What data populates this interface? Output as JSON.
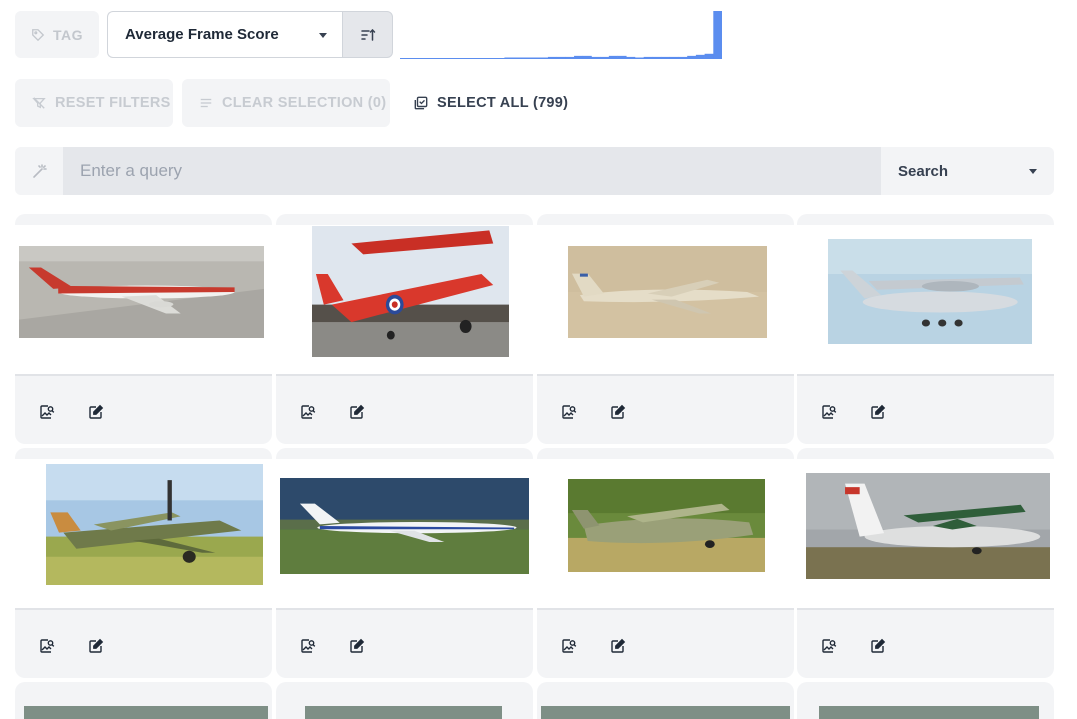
{
  "toolbar": {
    "tag_label": "TAG",
    "sort_field": "Average Frame Score",
    "reset_label": "RESET FILTERS",
    "clear_label": "CLEAR SELECTION (0)",
    "select_all_label": "SELECT ALL (799)"
  },
  "histogram": {
    "bar_color": "#5b8def",
    "values": [
      0,
      0,
      0,
      0,
      0,
      0,
      0,
      0,
      0,
      0,
      0,
      0,
      1,
      1,
      1,
      1,
      1,
      2,
      2,
      2,
      3,
      3,
      2,
      2,
      3,
      3,
      2,
      1,
      2,
      2,
      2,
      2,
      2,
      3,
      4,
      5,
      46
    ]
  },
  "query": {
    "placeholder": "Enter a query",
    "value": "",
    "search_mode": "Search"
  },
  "cards": [
    {
      "image": "aircraft photo 1",
      "scene": "airliner"
    },
    {
      "image": "aircraft photo 2",
      "scene": "redplane"
    },
    {
      "image": "aircraft photo 3",
      "scene": "seaplane"
    },
    {
      "image": "aircraft photo 4",
      "scene": "transport"
    },
    {
      "image": "aircraft photo 5",
      "scene": "warbird"
    },
    {
      "image": "aircraft photo 6",
      "scene": "jetliner"
    },
    {
      "image": "aircraft photo 7",
      "scene": "greenplane"
    },
    {
      "image": "aircraft photo 8",
      "scene": "cargo"
    },
    {
      "image": "aircraft photo 9",
      "scene": "partial"
    },
    {
      "image": "aircraft photo 10",
      "scene": "partial"
    },
    {
      "image": "aircraft photo 11",
      "scene": "partial"
    },
    {
      "image": "aircraft photo 12",
      "scene": "partial"
    }
  ],
  "icons": {
    "tag": "tag-icon",
    "sort_direction": "sort-ascending-icon",
    "reset": "filter-off-icon",
    "clear": "list-icon",
    "select_all": "select-all-icon",
    "wand": "magic-wand-icon",
    "view": "image-search-icon",
    "edit": "edit-icon"
  },
  "colors": {
    "accent": "#5b8def",
    "panel": "#f3f4f6",
    "disabled_text": "#c7cbd1"
  }
}
